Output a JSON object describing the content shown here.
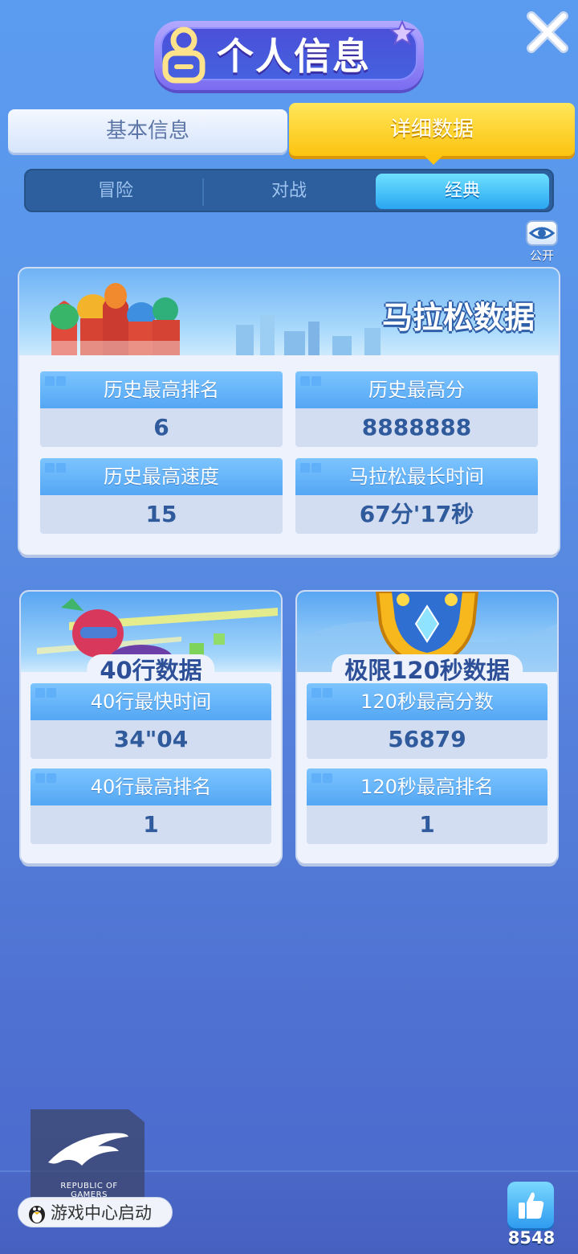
{
  "header": {
    "title": "个人信息"
  },
  "main_tabs": {
    "basic": "基本信息",
    "detail": "详细数据"
  },
  "sub_tabs": {
    "adventure": "冒险",
    "battle": "对战",
    "classic": "经典"
  },
  "public_toggle": {
    "label": "公开"
  },
  "marathon": {
    "title": "马拉松数据",
    "stats": [
      {
        "label": "历史最高排名",
        "value": "6"
      },
      {
        "label": "历史最高分",
        "value": "8888888"
      },
      {
        "label": "历史最高速度",
        "value": "15"
      },
      {
        "label": "马拉松最长时间",
        "value": "67分'17秒"
      }
    ]
  },
  "lines40": {
    "title": "40行数据",
    "stats": [
      {
        "label": "40行最快时间",
        "value": "34\"04"
      },
      {
        "label": "40行最高排名",
        "value": "1"
      }
    ]
  },
  "ultra120": {
    "title": "极限120秒数据",
    "stats": [
      {
        "label": "120秒最高分数",
        "value": "56879"
      },
      {
        "label": "120秒最高排名",
        "value": "1"
      }
    ]
  },
  "footer": {
    "rog_text": "REPUBLIC OF GAMERS",
    "launch_label": "游戏中心启动",
    "like_count": "8548"
  },
  "colors": {
    "accent_yellow": "#fcc410",
    "accent_blue": "#2aa6f2",
    "background": "#5a93e8"
  }
}
